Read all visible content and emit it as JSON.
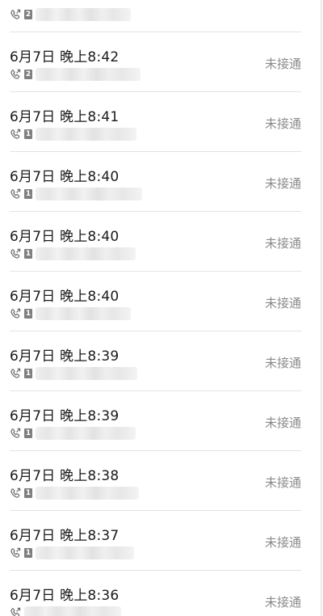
{
  "colors": {
    "text_primary": "#1a1a1a",
    "text_status": "#8a8a8a",
    "divider": "#e3e3e3",
    "sim_badge": "#7f7f7f"
  },
  "calls": [
    {
      "time": "",
      "sim": "2",
      "status": ""
    },
    {
      "time": "6月7日 晚上8:42",
      "sim": "2",
      "status": "未接通"
    },
    {
      "time": "6月7日 晚上8:41",
      "sim": "1",
      "status": "未接通"
    },
    {
      "time": "6月7日 晚上8:40",
      "sim": "1",
      "status": "未接通"
    },
    {
      "time": "6月7日 晚上8:40",
      "sim": "1",
      "status": "未接通"
    },
    {
      "time": "6月7日 晚上8:40",
      "sim": "1",
      "status": "未接通"
    },
    {
      "time": "6月7日 晚上8:39",
      "sim": "1",
      "status": "未接通"
    },
    {
      "time": "6月7日 晚上8:39",
      "sim": "1",
      "status": "未接通"
    },
    {
      "time": "6月7日 晚上8:38",
      "sim": "1",
      "status": "未接通"
    },
    {
      "time": "6月7日 晚上8:37",
      "sim": "1",
      "status": "未接通"
    },
    {
      "time": "6月7日 晚上8:36",
      "sim": "",
      "status": "未接通"
    }
  ],
  "icons": {
    "call_type": "outgoing-call-icon",
    "sim": "sim-badge-icon"
  }
}
